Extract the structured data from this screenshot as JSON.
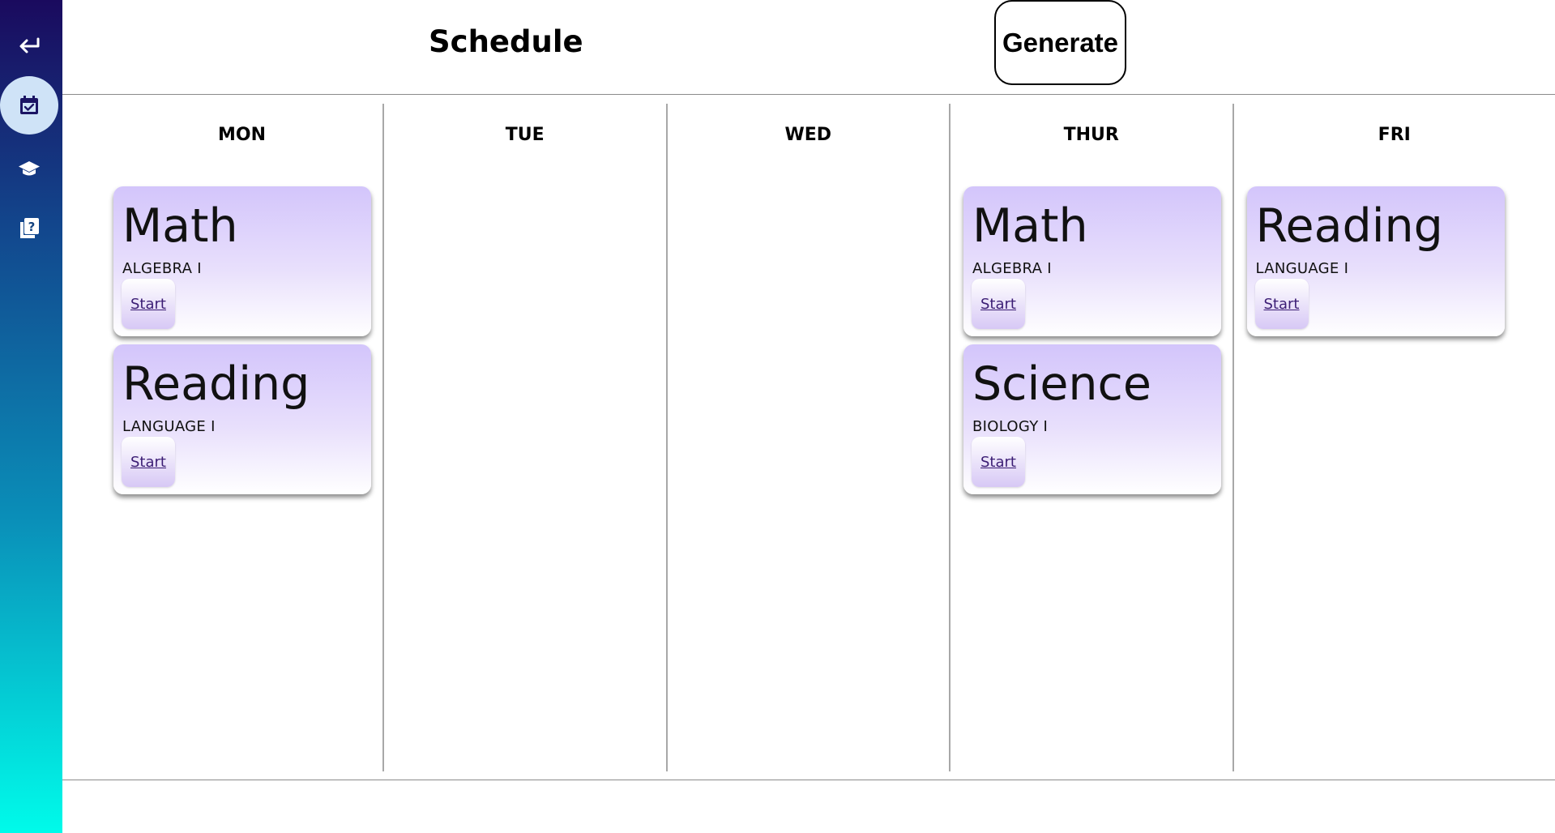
{
  "sidebar": {
    "items": [
      {
        "icon": "back-arrow-icon",
        "active": false
      },
      {
        "icon": "calendar-check-icon",
        "active": true
      },
      {
        "icon": "graduation-cap-icon",
        "active": false
      },
      {
        "icon": "question-book-icon",
        "active": false
      }
    ]
  },
  "header": {
    "title": "Schedule",
    "generate_label": "Generate"
  },
  "days": [
    {
      "label": "MON",
      "cards": [
        {
          "title": "Math",
          "subtitle": "ALGEBRA I",
          "action": "Start"
        },
        {
          "title": "Reading",
          "subtitle": "LANGUAGE I",
          "action": "Start"
        }
      ]
    },
    {
      "label": "TUE",
      "cards": []
    },
    {
      "label": "WED",
      "cards": []
    },
    {
      "label": "THUR",
      "cards": [
        {
          "title": "Math",
          "subtitle": "ALGEBRA I",
          "action": "Start"
        },
        {
          "title": "Science",
          "subtitle": "BIOLOGY I",
          "action": "Start"
        }
      ]
    },
    {
      "label": "FRI",
      "cards": [
        {
          "title": "Reading",
          "subtitle": "LANGUAGE I",
          "action": "Start"
        }
      ]
    }
  ],
  "colors": {
    "card_top": "#d3c5fb",
    "link": "#3b1d74",
    "active_nav": "#cfe3f7"
  }
}
